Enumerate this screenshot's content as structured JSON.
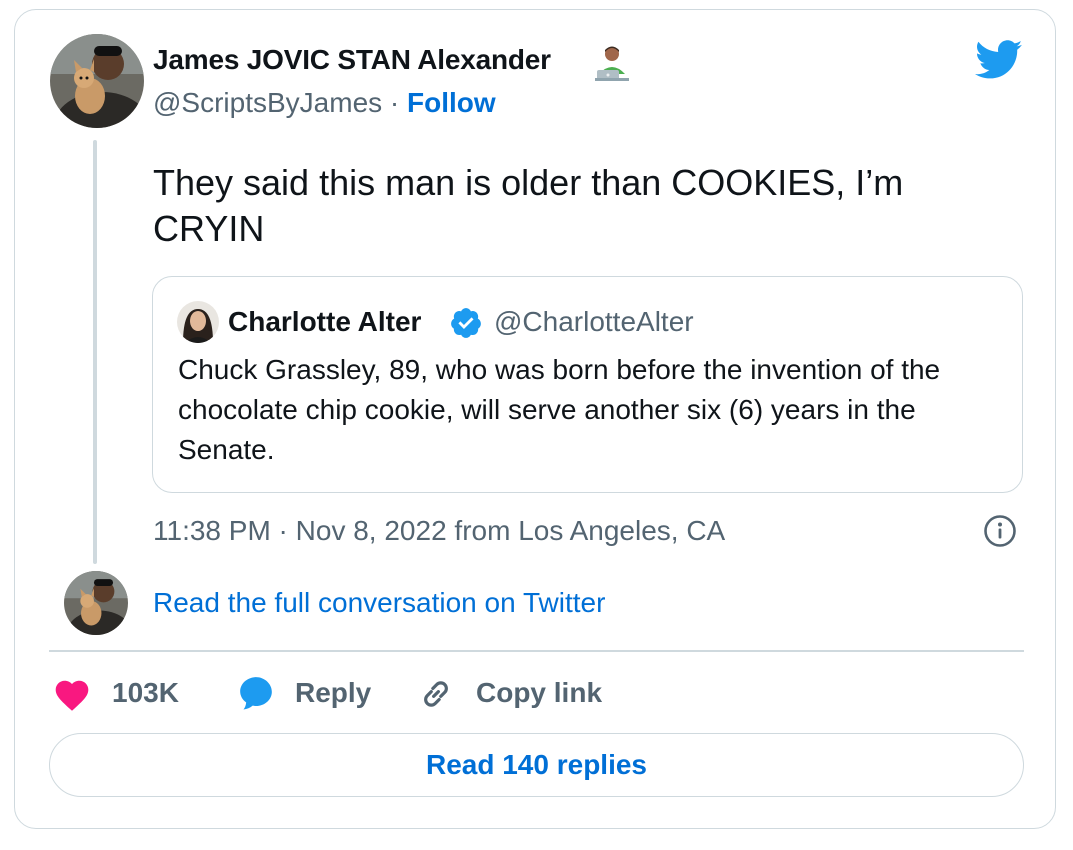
{
  "author": {
    "name": "James JOVIC STAN Alexander",
    "handle": "@ScriptsByJames",
    "separator": "·",
    "follow_label": "Follow"
  },
  "tweet": {
    "text": "They said this man is older than COOKIES, I’m CRYIN"
  },
  "quoted_tweet": {
    "name": "Charlotte Alter",
    "handle": "@CharlotteAlter",
    "text": "Chuck Grassley, 89, who was born before the invention of the chocolate chip cookie, will serve another six (6) years in the Senate."
  },
  "meta": {
    "timestamp": "11:38 PM · Nov 8, 2022 from Los Angeles, CA"
  },
  "conversation_link": "Read the full conversation on Twitter",
  "actions": {
    "like_count": "103K",
    "reply_label": "Reply",
    "copy_link_label": "Copy link"
  },
  "read_replies_label": "Read 140 replies",
  "icons": {
    "twitter_logo": "twitter-bird-icon",
    "verified": "verified-badge-icon",
    "info": "info-icon",
    "heart": "heart-icon",
    "reply": "speech-bubble-icon",
    "link": "link-icon",
    "emoji": "technologist-emoji"
  },
  "colors": {
    "link_blue": "#006fd6",
    "twitter_blue": "#1d9bf0",
    "heart_pink": "#f91880",
    "muted_text": "#536471",
    "border": "#cfd9de"
  }
}
